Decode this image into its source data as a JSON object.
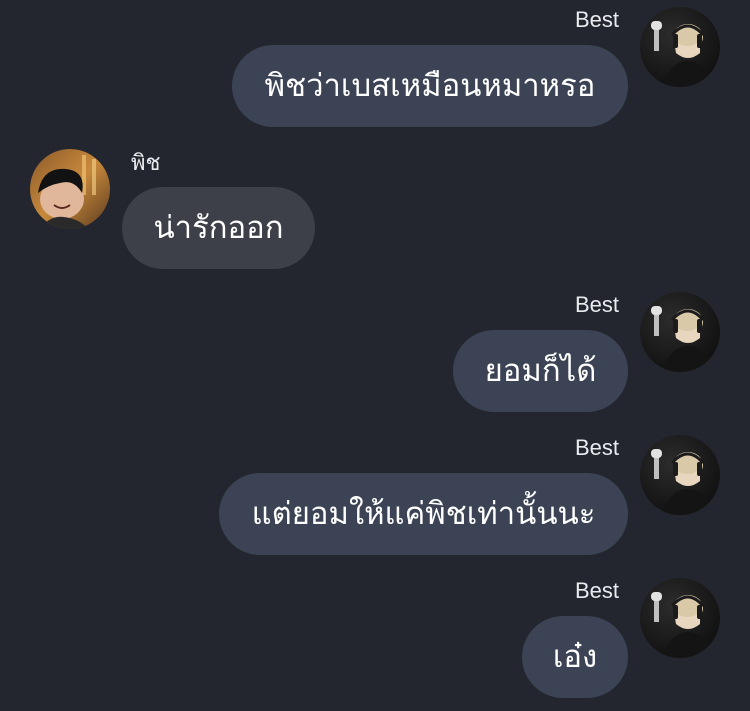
{
  "conversation": {
    "messages": [
      {
        "sender": "Best",
        "direction": "outgoing",
        "text": "พิชว่าเบสเหมือนหมาหรอ"
      },
      {
        "sender": "พิช",
        "direction": "incoming",
        "text": "น่ารักออก"
      },
      {
        "sender": "Best",
        "direction": "outgoing",
        "text": "ยอมก็ได้"
      },
      {
        "sender": "Best",
        "direction": "outgoing",
        "text": "แต่ยอมให้แค่พิชเท่านั้นนะ"
      },
      {
        "sender": "Best",
        "direction": "outgoing",
        "text": "เอ๋ง"
      }
    ]
  },
  "colors": {
    "background": "#23262e",
    "outgoing_bubble": "#3b4354",
    "incoming_bubble": "#3d4048",
    "text": "#ffffff"
  },
  "icons": {
    "outgoing_avatar": "best-avatar",
    "incoming_avatar": "pich-avatar"
  }
}
